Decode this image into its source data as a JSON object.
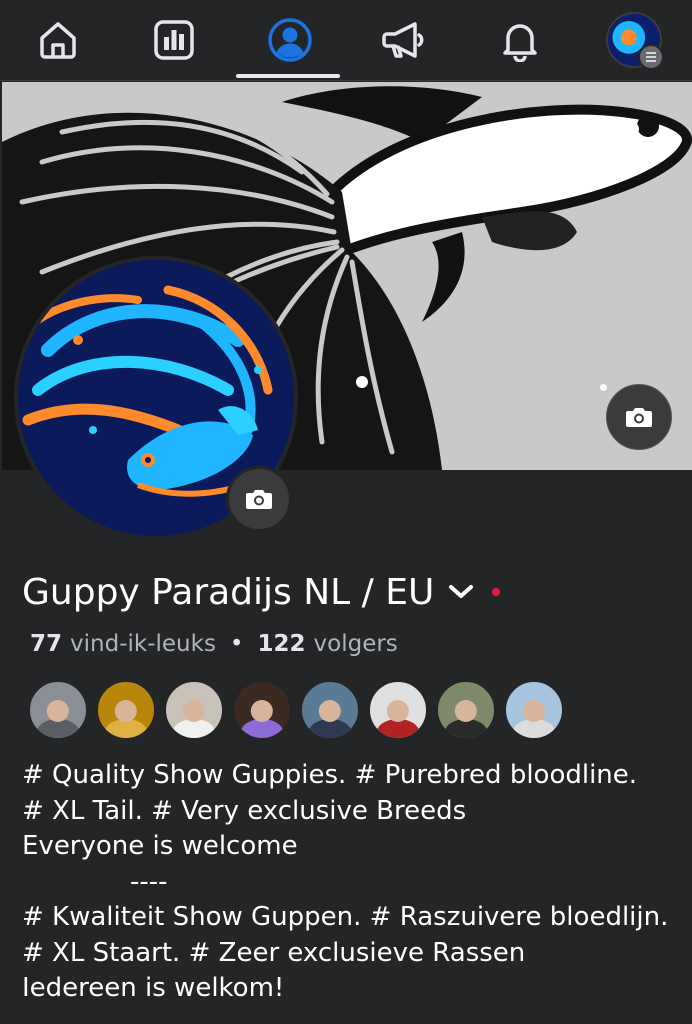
{
  "nav": {
    "items": [
      "home-icon",
      "dashboard-icon",
      "profile-icon",
      "megaphone-icon",
      "bell-icon",
      "account-avatar"
    ],
    "active_index": 2,
    "active_color": "#1b74e4"
  },
  "page": {
    "name": "Guppy Paradijs NL / EU",
    "likes_count": "77",
    "likes_label": "vind-ik-leuks",
    "followers_count": "122",
    "followers_label": "volgers",
    "separator": "•"
  },
  "friends": [
    {
      "bg": "#8a8f96",
      "shirt": "#5a5e66"
    },
    {
      "bg": "#b8860b",
      "shirt": "#e0b040"
    },
    {
      "bg": "#c9c2b8",
      "shirt": "#f0f0f0"
    },
    {
      "bg": "#3a2a22",
      "shirt": "#8e6bd8"
    },
    {
      "bg": "#5a7a96",
      "shirt": "#2f3a52"
    },
    {
      "bg": "#e0e0e0",
      "shirt": "#b22222"
    },
    {
      "bg": "#7e8a6a",
      "shirt": "#2a2a2a"
    },
    {
      "bg": "#a7c4de",
      "shirt": "#dcdcdc"
    }
  ],
  "bio": {
    "lines": [
      "# Quality Show Guppies. # Purebred bloodline.",
      "# XL Tail. # Very exclusive Breeds",
      "Everyone is welcome",
      "----",
      "# Kwaliteit Show Guppen. # Raszuivere bloedlijn.",
      "# XL Staart. # Zeer exclusieve Rassen",
      "Iedereen is welkom!"
    ]
  }
}
